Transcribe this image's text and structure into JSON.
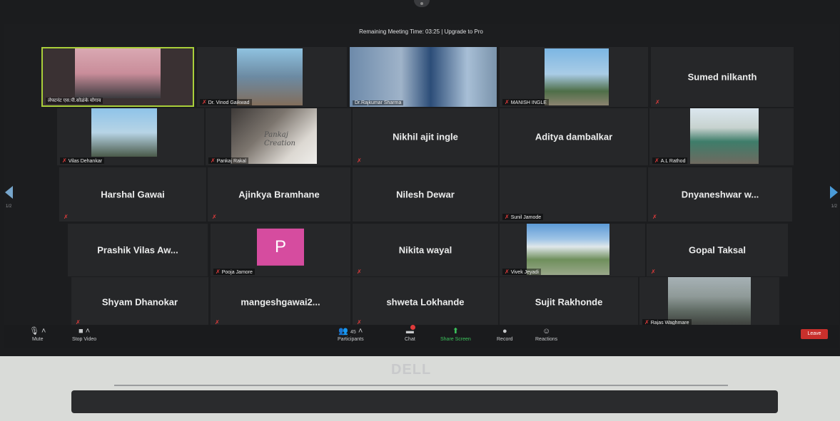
{
  "meeting": {
    "banner": "Remaining Meeting Time: 03:25 | Upgrade to Pro"
  },
  "brand": {
    "logo": "DELL"
  },
  "pagination": {
    "left": "1/2",
    "right": "1/2"
  },
  "participants": [
    {
      "display": "",
      "tag": "लेफ्टनंट एस.पी.सोळंके योगाव"
    },
    {
      "display": "",
      "tag": "Dr. Vinod Gaikwad"
    },
    {
      "display": "",
      "tag": "Dr.Rajkumar Sharma"
    },
    {
      "display": "",
      "tag": "MANISH INGLE"
    },
    {
      "display": "Sumed nilkanth",
      "tag": ""
    },
    {
      "display": "",
      "tag": "Vilas Dehankar"
    },
    {
      "display": "",
      "tag": "Pankaj Rakal",
      "overlay": "Pankaj Creation"
    },
    {
      "display": "Nikhil ajit ingle",
      "tag": ""
    },
    {
      "display": "Aditya dambalkar",
      "tag": ""
    },
    {
      "display": "",
      "tag": "A.L Rathod"
    },
    {
      "display": "Harshal Gawai",
      "tag": ""
    },
    {
      "display": "Ajinkya Bramhane",
      "tag": ""
    },
    {
      "display": "Nilesh Dewar",
      "tag": ""
    },
    {
      "display": "",
      "tag": "Sunil Jamode"
    },
    {
      "display": "Dnyaneshwar w...",
      "tag": ""
    },
    {
      "display": "Prashik Vilas Aw...",
      "tag": ""
    },
    {
      "display": "",
      "tag": "Pooja Jamore",
      "avatar": "P"
    },
    {
      "display": "Nikita wayal",
      "tag": ""
    },
    {
      "display": "",
      "tag": "Vivek Jeyadi"
    },
    {
      "display": "Gopal Taksal",
      "tag": ""
    },
    {
      "display": "Shyam Dhanokar",
      "tag": ""
    },
    {
      "display": "mangeshgawai2...",
      "tag": ""
    },
    {
      "display": "shweta Lokhande",
      "tag": ""
    },
    {
      "display": "Sujit Rakhonde",
      "tag": ""
    },
    {
      "display": "",
      "tag": "Rajas Waghmare"
    }
  ],
  "toolbar": {
    "mute": "Mute",
    "stop_video": "Stop Video",
    "participants": "Participants",
    "participants_count": "45",
    "chat": "Chat",
    "share_screen": "Share Screen",
    "record": "Record",
    "reactions": "Reactions",
    "leave": "Leave"
  },
  "colors": {
    "active_speaker_border": "#a9cf3a",
    "muted_icon": "#e03b3b",
    "share_screen": "#3cc35c",
    "leave_button": "#c9302c"
  }
}
